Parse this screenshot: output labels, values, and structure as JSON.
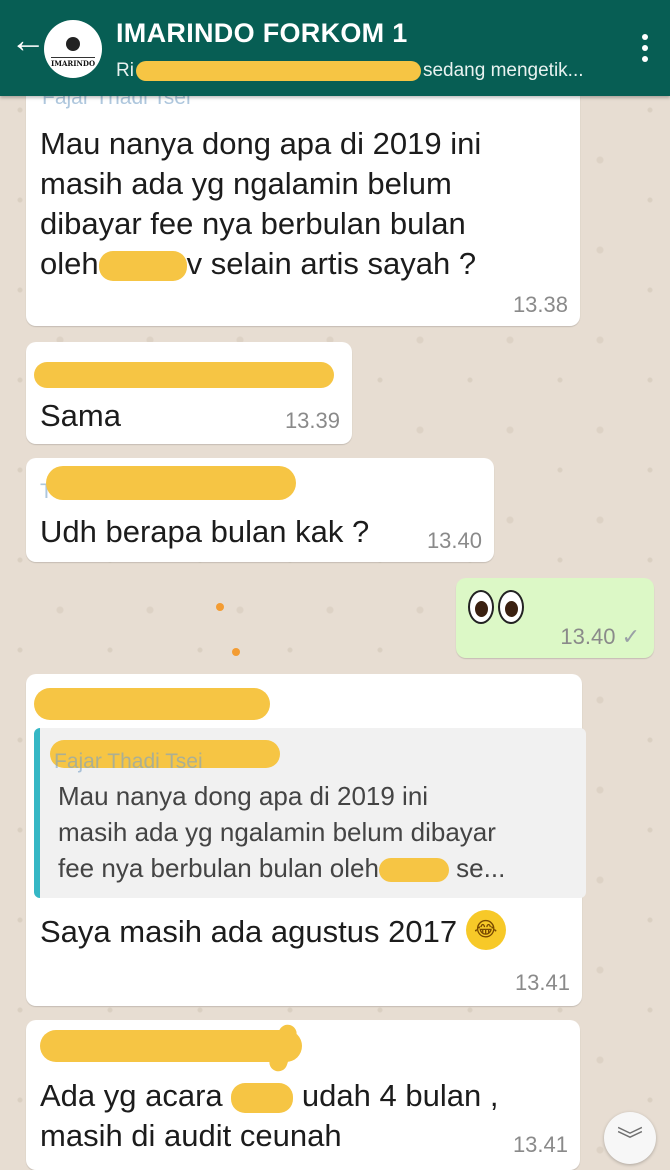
{
  "header": {
    "back_icon": "arrow-left-icon",
    "avatar_label": "IMARINDO",
    "title": "IMARINDO FORKOM 1",
    "subtitle_prefix": "Ri",
    "subtitle_suffix": "sedang mengetik...",
    "menu_icon": "more-vert-icon"
  },
  "colors": {
    "header": "#075e54",
    "wallpaper": "#e7ddd2",
    "outgoing": "#dcf8c6",
    "redaction": "#f6c544",
    "quote_bar": "#35b7c5"
  },
  "messages": [
    {
      "sender": "Fajar Thadi Tsei",
      "lines": [
        "Mau nanya dong apa di 2019 ini",
        "masih ada yg ngalamin belum",
        "dibayar fee nya berbulan bulan"
      ],
      "line4_prefix": "oleh",
      "line4_suffix": "v selain artis sayah ?",
      "time": "13.38"
    },
    {
      "text": "Sama",
      "time": "13.39"
    },
    {
      "sender": "T",
      "text": "Udh berapa bulan kak ?",
      "time": "13.40"
    },
    {
      "time": "13.40",
      "status_icon": "double-check-icon",
      "emoji": "eyes-emoji"
    },
    {
      "quoted_sender": "Fajar Thadi Tsei",
      "quoted_lines": [
        "Mau nanya dong apa di 2019 ini",
        "masih ada yg ngalamin belum dibayar"
      ],
      "quoted_line3_prefix": "fee nya berbulan bulan oleh",
      "quoted_line3_suffix": "se...",
      "text": "Saya masih ada agustus 2017",
      "emoji": "face-with-tears-of-joy-emoji",
      "time": "13.41"
    },
    {
      "line1_prefix": "Ada yg acara",
      "line1_suffix": "udah 4 bulan ,",
      "line2": "masih di audit ceunah",
      "time": "13.41"
    }
  ],
  "scroll_icon": "double-chevron-down-icon"
}
